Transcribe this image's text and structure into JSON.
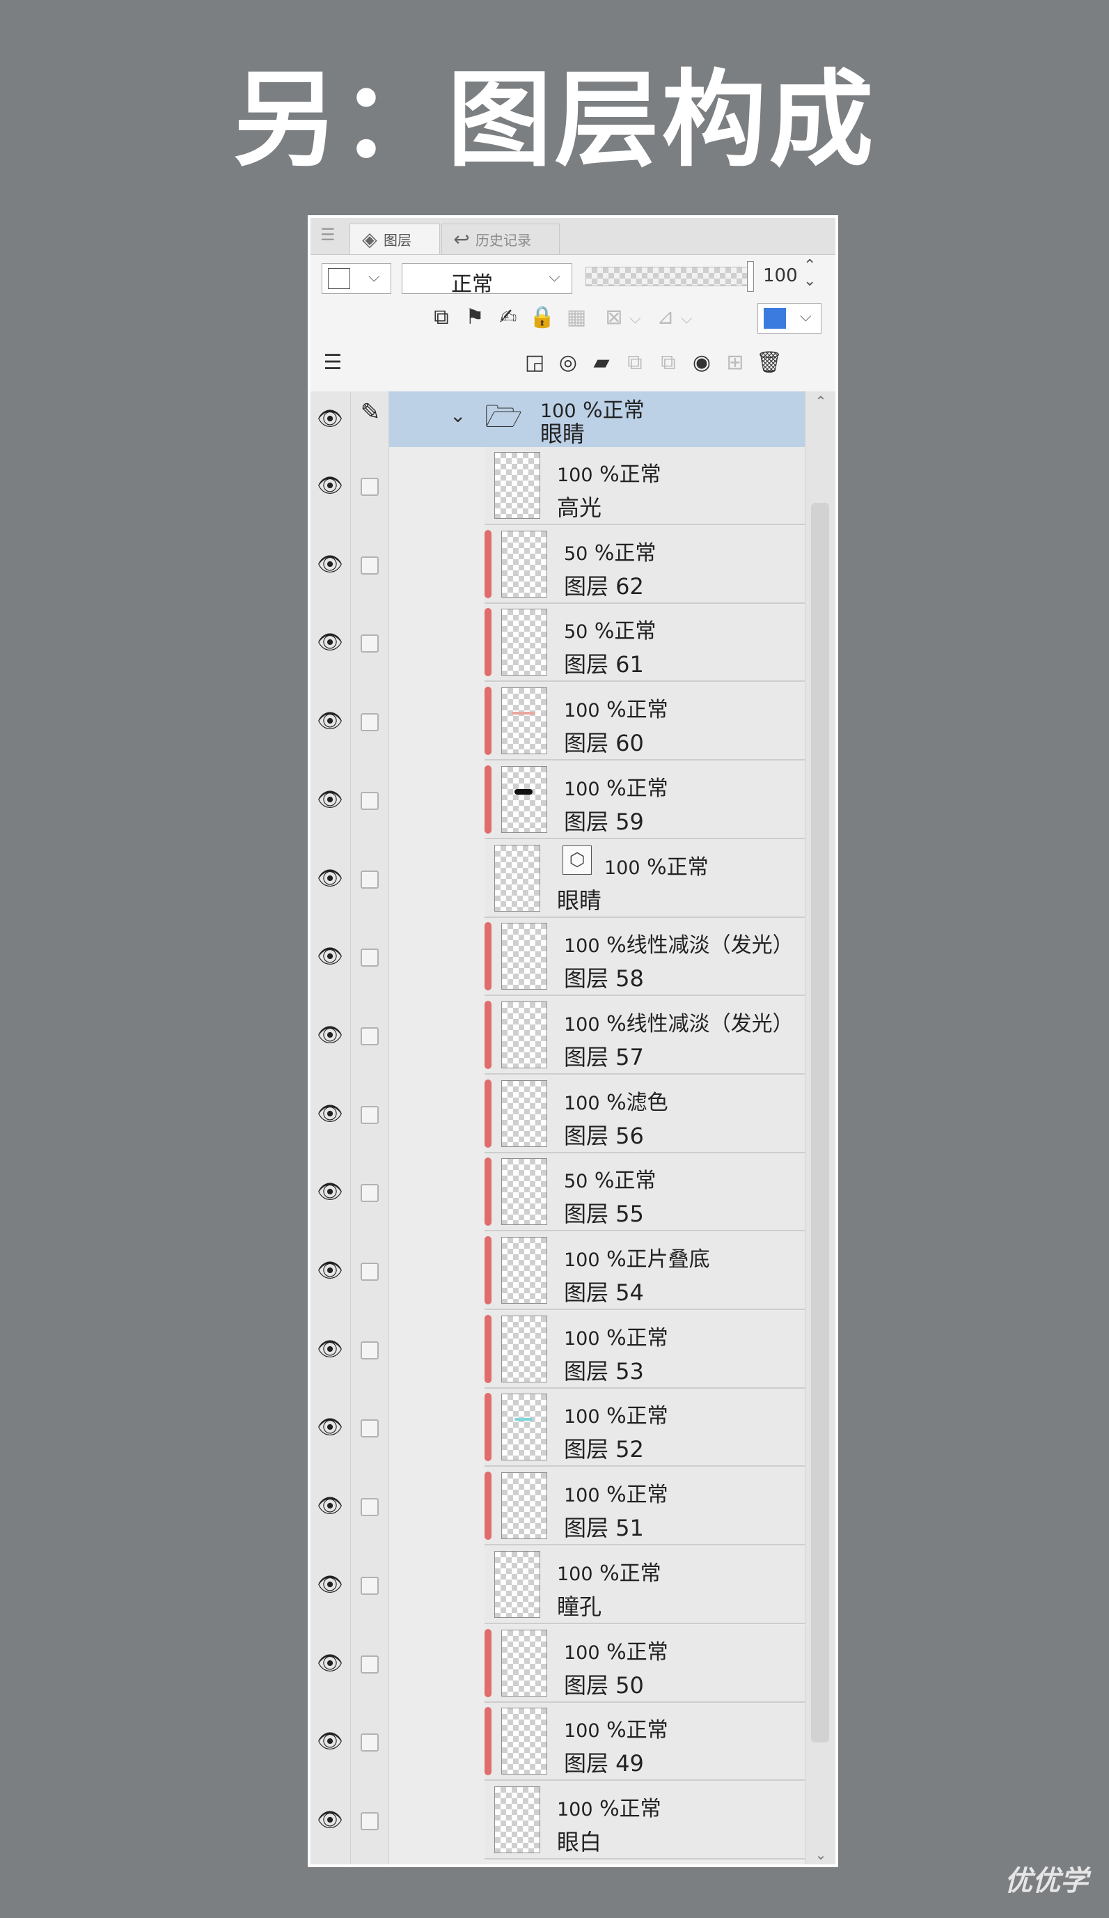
{
  "heading": "另：图层构成",
  "tabs": [
    {
      "label": "图层",
      "icon": "layers-icon"
    },
    {
      "label": "历史记录",
      "icon": "history-icon"
    }
  ],
  "toolbar": {
    "blend_mode": "正常",
    "opacity_value": "100",
    "opacity_level": 1.0,
    "accent_color": "#3b7be0"
  },
  "folder": {
    "opacity": "100",
    "mode_text": "%正常",
    "name": "眼睛"
  },
  "layers": [
    {
      "opacity": "100",
      "mode": "%正常",
      "name": "高光",
      "clip": false
    },
    {
      "opacity": "50",
      "mode": "%正常",
      "name": "图层 62",
      "clip": true
    },
    {
      "opacity": "50",
      "mode": "%正常",
      "name": "图层 61",
      "clip": true
    },
    {
      "opacity": "100",
      "mode": "%正常",
      "name": "图层 60",
      "clip": true,
      "mark": "pink-stroke"
    },
    {
      "opacity": "100",
      "mode": "%正常",
      "name": "图层 59",
      "clip": true,
      "mark": "black-dots"
    },
    {
      "opacity": "100",
      "mode": "%正常",
      "name": "眼睛",
      "clip": false,
      "is_3d": true
    },
    {
      "opacity": "100",
      "mode": "%线性减淡（发光）",
      "name": "图层 58",
      "clip": true
    },
    {
      "opacity": "100",
      "mode": "%线性减淡（发光）",
      "name": "图层 57",
      "clip": true
    },
    {
      "opacity": "100",
      "mode": "%滤色",
      "name": "图层 56",
      "clip": true
    },
    {
      "opacity": "50",
      "mode": "%正常",
      "name": "图层 55",
      "clip": true
    },
    {
      "opacity": "100",
      "mode": "%正片叠底",
      "name": "图层 54",
      "clip": true
    },
    {
      "opacity": "100",
      "mode": "%正常",
      "name": "图层 53",
      "clip": true
    },
    {
      "opacity": "100",
      "mode": "%正常",
      "name": "图层 52",
      "clip": true,
      "mark": "cyan-stroke"
    },
    {
      "opacity": "100",
      "mode": "%正常",
      "name": "图层 51",
      "clip": true
    },
    {
      "opacity": "100",
      "mode": "%正常",
      "name": "瞳孔",
      "clip": false
    },
    {
      "opacity": "100",
      "mode": "%正常",
      "name": "图层 50",
      "clip": true
    },
    {
      "opacity": "100",
      "mode": "%正常",
      "name": "图层 49",
      "clip": true
    },
    {
      "opacity": "100",
      "mode": "%正常",
      "name": "眼白",
      "clip": false
    }
  ],
  "watermark": "优优学"
}
